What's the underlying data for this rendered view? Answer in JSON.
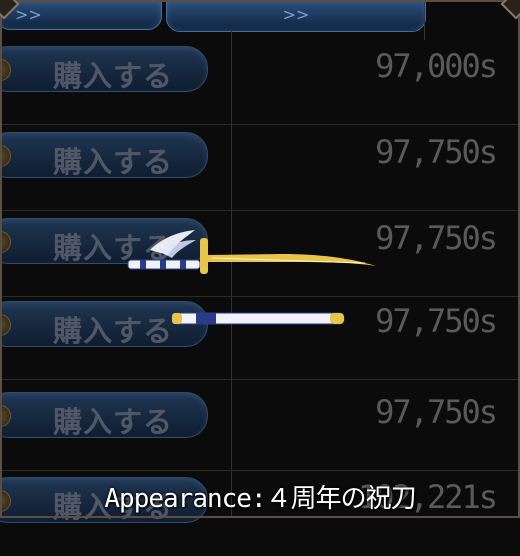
{
  "tabs": {
    "tab1_label": ">>",
    "tab2_label": ">>"
  },
  "rows": [
    {
      "button_label": "購入する",
      "price": "97,000s"
    },
    {
      "button_label": "購入する",
      "price": "97,750s"
    },
    {
      "button_label": "購入する",
      "price": "97,750s"
    },
    {
      "button_label": "購入する",
      "price": "97,750s"
    },
    {
      "button_label": "購入する",
      "price": "97,750s"
    },
    {
      "button_label": "購入する",
      "price": "102,221s"
    }
  ],
  "item_preview": {
    "caption": "Appearance:４周年の祝刀",
    "blade_color": "#e8c44a",
    "sheath_color": "#f1f3fb"
  }
}
